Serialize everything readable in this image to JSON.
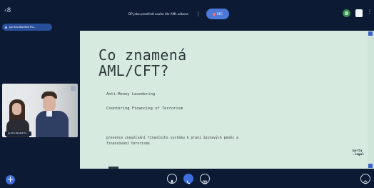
{
  "header": {
    "back_label": "‹8",
    "meeting_title": "DP jako prostředí souhu dle AML zákona",
    "recording_label": "REC",
    "menu_glyph": "⋮"
  },
  "presenter": {
    "name": "Jan Bíra Barešák Pro..."
  },
  "camera_tile": {
    "label": "Jan Bíra Barešák Pro..."
  },
  "slide": {
    "title_line1": "Co znamená",
    "title_line2": "AML/CFT?",
    "line1": "Anti-Money Laundering",
    "line2": "Countering Financing of Terrorism",
    "line3": "prevence zneužívání finančního systému k praní špinavých peněz a",
    "line4": "financování terorismu",
    "logo_line1": "barta",
    "logo_line2": ".legal"
  },
  "toolbar": {
    "add_glyph": "+"
  },
  "colors": {
    "background": "#0c1a33",
    "slide_bg": "#d7eadf",
    "accent": "#3d6fe0"
  },
  "icons": [
    "back-icon",
    "record-icon",
    "menu-icon",
    "microphone-icon",
    "call-icon",
    "share-screen-icon",
    "more-icon",
    "add-icon"
  ]
}
